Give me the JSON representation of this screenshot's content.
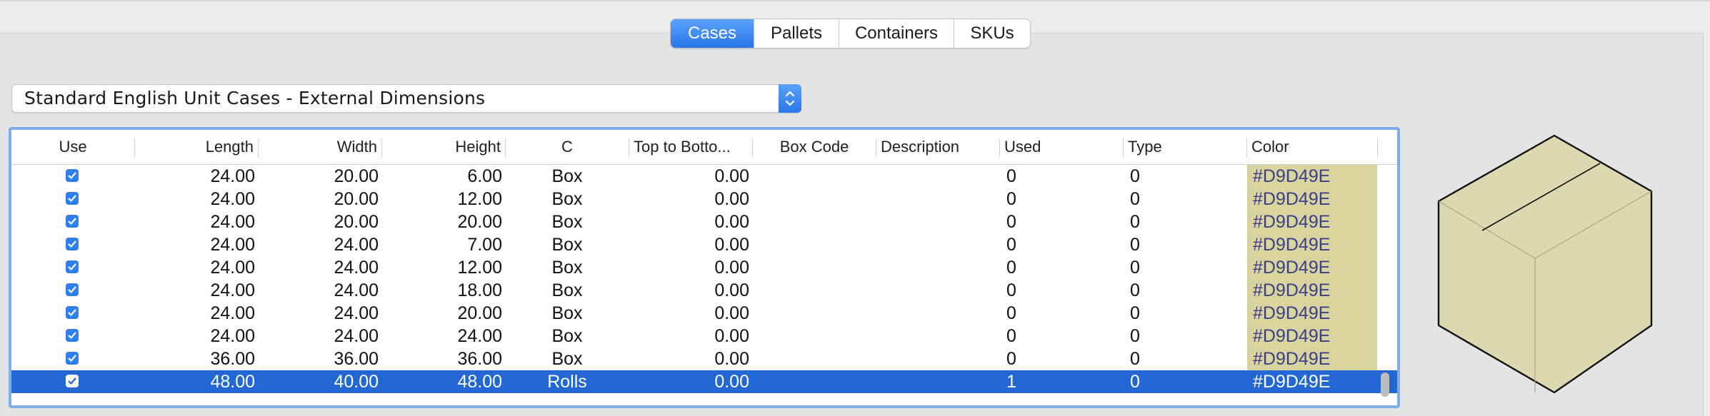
{
  "tabs": [
    "Cases",
    "Pallets",
    "Containers",
    "SKUs"
  ],
  "active_tab": "Cases",
  "popup": {
    "selected": "Standard English Unit Cases - External Dimensions"
  },
  "table": {
    "columns": [
      "Use",
      "Length",
      "Width",
      "Height",
      "C",
      "Top to Botto...",
      "Box Code",
      "Description",
      "Used",
      "Type",
      "Color"
    ],
    "rows": [
      {
        "use": true,
        "length": "24.00",
        "width": "20.00",
        "height": "6.00",
        "c": "Box",
        "top": "0.00",
        "box_code": "",
        "description": "",
        "used": "0",
        "type": "0",
        "color": "#D9D49E"
      },
      {
        "use": true,
        "length": "24.00",
        "width": "20.00",
        "height": "12.00",
        "c": "Box",
        "top": "0.00",
        "box_code": "",
        "description": "",
        "used": "0",
        "type": "0",
        "color": "#D9D49E"
      },
      {
        "use": true,
        "length": "24.00",
        "width": "20.00",
        "height": "20.00",
        "c": "Box",
        "top": "0.00",
        "box_code": "",
        "description": "",
        "used": "0",
        "type": "0",
        "color": "#D9D49E"
      },
      {
        "use": true,
        "length": "24.00",
        "width": "24.00",
        "height": "7.00",
        "c": "Box",
        "top": "0.00",
        "box_code": "",
        "description": "",
        "used": "0",
        "type": "0",
        "color": "#D9D49E"
      },
      {
        "use": true,
        "length": "24.00",
        "width": "24.00",
        "height": "12.00",
        "c": "Box",
        "top": "0.00",
        "box_code": "",
        "description": "",
        "used": "0",
        "type": "0",
        "color": "#D9D49E"
      },
      {
        "use": true,
        "length": "24.00",
        "width": "24.00",
        "height": "18.00",
        "c": "Box",
        "top": "0.00",
        "box_code": "",
        "description": "",
        "used": "0",
        "type": "0",
        "color": "#D9D49E"
      },
      {
        "use": true,
        "length": "24.00",
        "width": "24.00",
        "height": "20.00",
        "c": "Box",
        "top": "0.00",
        "box_code": "",
        "description": "",
        "used": "0",
        "type": "0",
        "color": "#D9D49E"
      },
      {
        "use": true,
        "length": "24.00",
        "width": "24.00",
        "height": "24.00",
        "c": "Box",
        "top": "0.00",
        "box_code": "",
        "description": "",
        "used": "0",
        "type": "0",
        "color": "#D9D49E"
      },
      {
        "use": true,
        "length": "36.00",
        "width": "36.00",
        "height": "36.00",
        "c": "Box",
        "top": "0.00",
        "box_code": "",
        "description": "",
        "used": "0",
        "type": "0",
        "color": "#D9D49E"
      },
      {
        "use": true,
        "length": "48.00",
        "width": "40.00",
        "height": "48.00",
        "c": "Rolls",
        "top": "0.00",
        "box_code": "",
        "description": "",
        "used": "1",
        "type": "0",
        "color": "#D9D49E",
        "selected": true
      }
    ]
  },
  "icons": {
    "popup": "up-down-chevron-icon",
    "checkbox": "checkmark-icon",
    "preview": "box-3d-preview"
  },
  "colors": {
    "accent": "#2a76ec",
    "selection": "#2267d3",
    "case_fill": "#D9D49E",
    "focus_ring": "#7eacea"
  }
}
